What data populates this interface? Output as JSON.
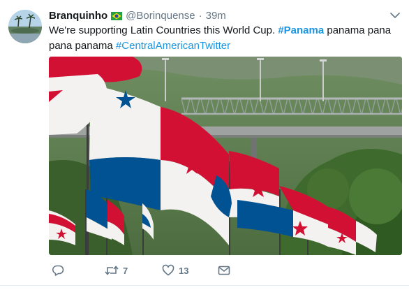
{
  "tweet": {
    "display_name": "Branquinho",
    "name_flag": "flag-brazil-icon",
    "handle": "@Borinquense",
    "separator": "·",
    "time": "39m",
    "text_segments": [
      {
        "text": "We're supporting Latin Countries this World Cup. ",
        "type": "plain"
      },
      {
        "text": "#Panama",
        "type": "hashtag-bold"
      },
      {
        "text": " panama pana pana panama ",
        "type": "plain"
      },
      {
        "text": "#CentralAmericanTwitter",
        "type": "hashtag"
      }
    ],
    "media_description_icon": "panama-flags-photo",
    "actions": {
      "reply_count": "",
      "retweet_count": "7",
      "like_count": "13"
    }
  },
  "colors": {
    "text": "#14171a",
    "secondary": "#657786",
    "link": "#1b95e0",
    "panama_red": "#d21034",
    "panama_blue": "#005293"
  }
}
